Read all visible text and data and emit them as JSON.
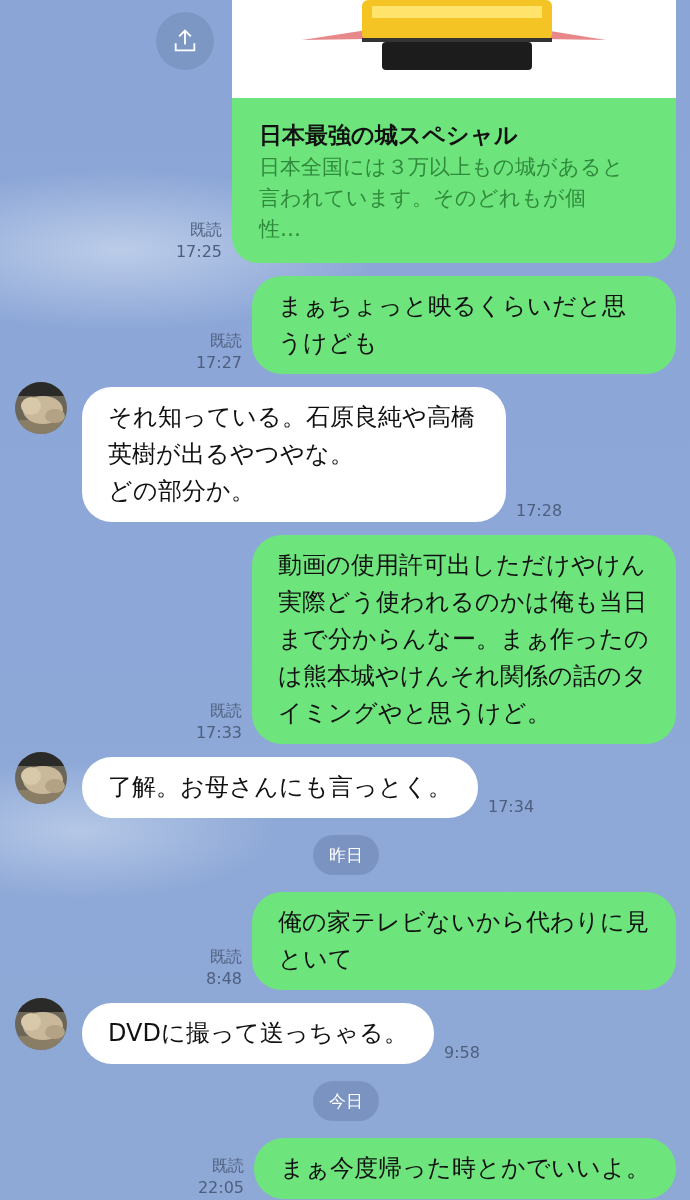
{
  "messages": [
    {
      "kind": "sent_link",
      "title": "日本最強の城スペシャル",
      "description": "日本全国には３万以上もの城があると言われています。そのどれもが個性…",
      "read": "既読",
      "time": "17:25"
    },
    {
      "kind": "sent_text",
      "text": "まぁちょっと映るくらいだと思うけども",
      "read": "既読",
      "time": "17:27"
    },
    {
      "kind": "received_text",
      "paragraphs": [
        "それ知っている。石原良純や高橋英樹が出るやつやな。",
        "どの部分か。"
      ],
      "time": "17:28"
    },
    {
      "kind": "sent_text",
      "text": "動画の使用許可出しただけやけん実際どう使われるのかは俺も当日まで分からんなー。まぁ作ったのは熊本城やけんそれ関係の話のタイミングやと思うけど。",
      "read": "既読",
      "time": "17:33"
    },
    {
      "kind": "received_text",
      "text": "了解。お母さんにも言っとく。",
      "time": "17:34"
    },
    {
      "kind": "date",
      "text": "昨日"
    },
    {
      "kind": "sent_text",
      "text": "俺の家テレビないから代わりに見といて",
      "read": "既読",
      "time": "8:48"
    },
    {
      "kind": "received_text",
      "text": "DVDに撮って送っちゃる。",
      "time": "9:58"
    },
    {
      "kind": "date",
      "text": "今日"
    },
    {
      "kind": "sent_text",
      "text": "まぁ今度帰った時とかでいいよ。",
      "read": "既読",
      "time": "22:05"
    }
  ]
}
